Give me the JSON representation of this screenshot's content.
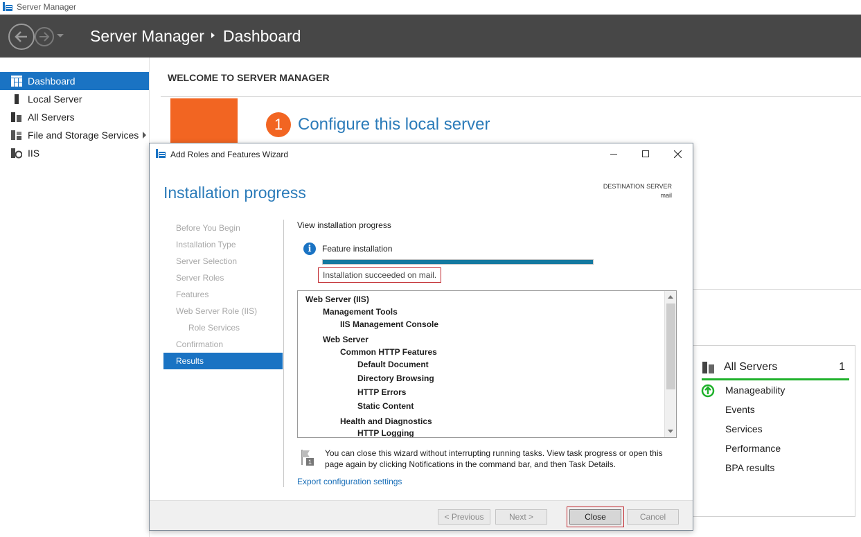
{
  "window": {
    "title": "Server Manager"
  },
  "header": {
    "breadcrumb_root": "Server Manager",
    "breadcrumb_page": "Dashboard"
  },
  "sidebar": {
    "items": [
      {
        "label": "Dashboard",
        "active": true
      },
      {
        "label": "Local Server"
      },
      {
        "label": "All Servers"
      },
      {
        "label": "File and Storage Services",
        "has_arrow": true
      },
      {
        "label": "IIS"
      }
    ]
  },
  "dashboard": {
    "welcome": "WELCOME TO SERVER MANAGER",
    "configure_number": "1",
    "configure_text": "Configure this local server"
  },
  "tile": {
    "title": "All Servers",
    "count": "1",
    "rows": [
      "Manageability",
      "Events",
      "Services",
      "Performance",
      "BPA results"
    ],
    "accent_color": "#1fb12b"
  },
  "wizard": {
    "title": "Add Roles and Features Wizard",
    "heading": "Installation progress",
    "destination_label": "DESTINATION SERVER",
    "destination_value": "mail",
    "steps": [
      {
        "label": "Before You Begin"
      },
      {
        "label": "Installation Type"
      },
      {
        "label": "Server Selection"
      },
      {
        "label": "Server Roles"
      },
      {
        "label": "Features"
      },
      {
        "label": "Web Server Role (IIS)"
      },
      {
        "label": "Role Services",
        "sub": true
      },
      {
        "label": "Confirmation"
      },
      {
        "label": "Results",
        "active": true
      }
    ],
    "view_progress": "View installation progress",
    "feature_installation": "Feature installation",
    "progress_fraction": 1.0,
    "status": "Installation succeeded on mail.",
    "tree": [
      {
        "text": "Web Server (IIS)",
        "level": 0
      },
      {
        "text": "Management Tools",
        "level": 1
      },
      {
        "text": "IIS Management Console",
        "level": 2
      },
      {
        "text": "Web Server",
        "level": 1
      },
      {
        "text": "Common HTTP Features",
        "level": 2
      },
      {
        "text": "Default Document",
        "level": 3
      },
      {
        "text": "Directory Browsing",
        "level": 3
      },
      {
        "text": "HTTP Errors",
        "level": 3
      },
      {
        "text": "Static Content",
        "level": 3
      },
      {
        "text": "Health and Diagnostics",
        "level": 2
      },
      {
        "text": "HTTP Logging",
        "level": 3
      }
    ],
    "note_line1": "You can close this wizard without interrupting running tasks. View task progress or open this",
    "note_line2": "page again by clicking Notifications in the command bar, and then Task Details.",
    "export_link": "Export configuration settings",
    "buttons": {
      "previous": "< Previous",
      "next": "Next >",
      "close": "Close",
      "cancel": "Cancel"
    },
    "accent_color": "#1a73c3",
    "highlight_color": "#c0272d"
  }
}
